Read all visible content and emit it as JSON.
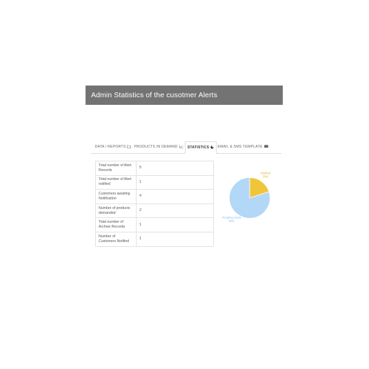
{
  "header": {
    "title": "Admin Statistics of the cusotmer Alerts",
    "background": "#737373"
  },
  "tabs": [
    {
      "label": "DATA / REPORTS",
      "icon": "folder-icon",
      "active": false
    },
    {
      "label": "PRODUCTS IN DEMAND",
      "icon": "line-chart-icon",
      "active": false
    },
    {
      "label": "STATISTICS",
      "icon": "pie-chart-icon",
      "active": true
    },
    {
      "label": "EMAIL & SMS TEMPLATE",
      "icon": "envelope-icon",
      "active": false
    }
  ],
  "stats_table": {
    "rows": [
      {
        "label": "Total number of Alert Records",
        "value": "5"
      },
      {
        "label": "Total number of Alert notified",
        "value": "1"
      },
      {
        "label": "Customers awaiting Notification",
        "value": "4"
      },
      {
        "label": "Number of products demanded",
        "value": "2"
      },
      {
        "label": "Total number of Archive Records",
        "value": "1"
      },
      {
        "label": "Number of Customers Notified",
        "value": "1"
      }
    ]
  },
  "chart_data": {
    "type": "pie",
    "slices": [
      {
        "name": "Notified",
        "value": 20,
        "label": "20%",
        "color": "#f0c53c"
      },
      {
        "name": "Pending Alerts",
        "value": 80,
        "label": "80%",
        "color": "#b3d8f7"
      }
    ]
  }
}
